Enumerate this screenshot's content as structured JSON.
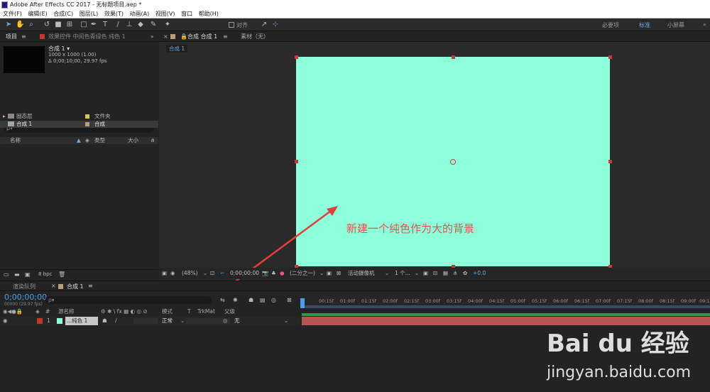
{
  "titlebar": {
    "title": "Adobe After Effects CC 2017 - 无标题项目.aep *"
  },
  "menu": [
    "文件(F)",
    "编辑(E)",
    "合成(C)",
    "图层(L)",
    "效果(T)",
    "动画(A)",
    "视图(V)",
    "窗口",
    "帮助(H)"
  ],
  "toolbar": {
    "align_label": "对齐",
    "workspaces": [
      "必要项",
      "标准",
      "小屏幕"
    ],
    "active_workspace": "标准"
  },
  "project": {
    "tab_label": "项目",
    "effects_tab": "效果控件 中间色青绿色 纯色 1",
    "comp_name": "合成 1 ▾",
    "comp_info1": "1000 x 1000 (1.00)",
    "comp_info2": "Δ 0;00;10;00, 29.97 fps",
    "search_placeholder": "ρ▾",
    "columns": [
      "名称",
      "类型",
      "大小"
    ],
    "rows": [
      {
        "name": "固态层",
        "type": "文件夹"
      },
      {
        "name": "合成 1",
        "type": "合成"
      }
    ],
    "bpc": "8 bpc"
  },
  "viewer": {
    "tab_label": "合成 合成 1",
    "footage_tab": "素材（无）",
    "comp_chip": "合成 1",
    "canvas_color": "#8effdb",
    "zoom": "(48%)",
    "timecode": "0;00;00;00",
    "resolution": "(二分之一)",
    "camera": "活动摄像机",
    "views": "1 个...",
    "exposure": "+0.0"
  },
  "timeline": {
    "render_queue_tab": "渲染队列",
    "comp_tab": "合成 1",
    "timecode": "0;00;00;00",
    "fps_info": "00000 (29.97 fps)",
    "search_placeholder": "ρ▾",
    "cols": {
      "source": "源名称",
      "mode": "模式",
      "t": "T",
      "trkmat": "TrkMat",
      "parent": "父级"
    },
    "layer": {
      "num": "1",
      "name": "...纯色 1",
      "mode": "正常",
      "parent": "无"
    },
    "ticks": [
      "0f",
      "00:15f",
      "01:00f",
      "01:15f",
      "02:00f",
      "02:15f",
      "03:00f",
      "03:15f",
      "04:00f",
      "04:15f",
      "05:00f",
      "05:15f",
      "06:00f",
      "06:15f",
      "07:00f",
      "07:15f",
      "08:00f",
      "08:15f",
      "09:00f",
      "09:15f"
    ]
  },
  "annotation": {
    "text": "新建一个纯色作为大的背景"
  },
  "watermark": {
    "brand": "Bai du 经验",
    "url": "jingyan.baidu.com"
  }
}
